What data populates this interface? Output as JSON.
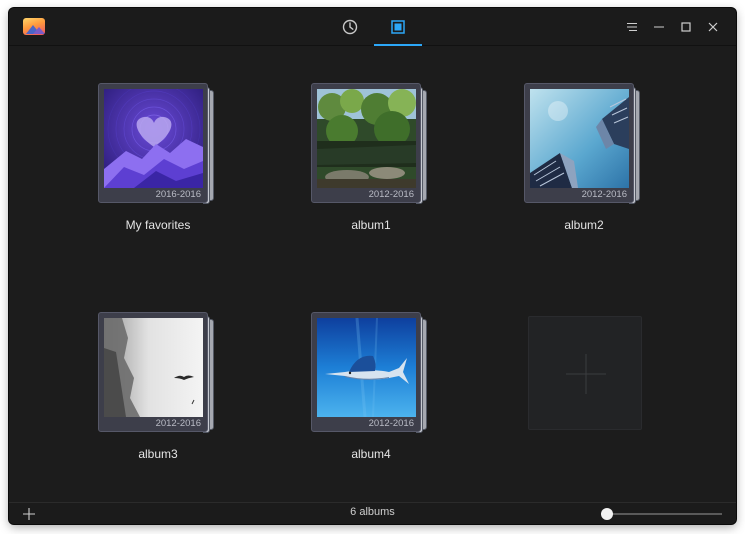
{
  "titlebar": {
    "tabs": [
      {
        "name": "timeline",
        "icon": "clock-icon",
        "active": false
      },
      {
        "name": "albums",
        "icon": "album-icon",
        "active": true
      }
    ],
    "window_buttons": [
      "menu-icon",
      "minimize-icon",
      "maximize-icon",
      "close-icon"
    ]
  },
  "albums": [
    {
      "name": "My favorites",
      "date": "2016-2016"
    },
    {
      "name": "album1",
      "date": "2012-2016"
    },
    {
      "name": "album2",
      "date": "2012-2016"
    },
    {
      "name": "album3",
      "date": "2012-2016"
    },
    {
      "name": "album4",
      "date": "2012-2016"
    }
  ],
  "statusbar": {
    "count": "6 albums",
    "zoom_fraction": 0.0
  },
  "colors": {
    "accent": "#2ca7f8",
    "background": "#1c1c1c"
  }
}
